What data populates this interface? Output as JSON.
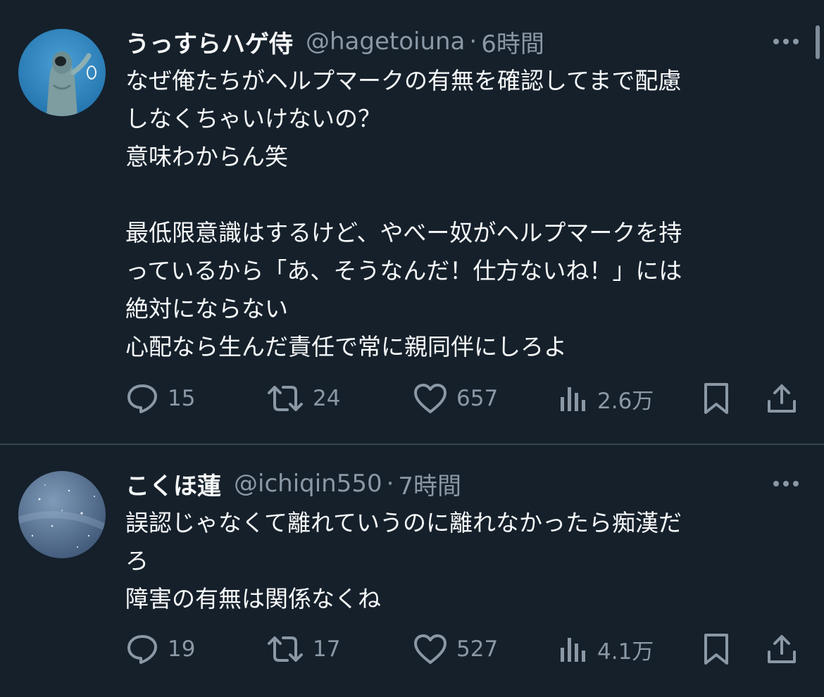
{
  "tweets": [
    {
      "display_name": "うっすらハゲ侍",
      "handle": "@hagetoiuna",
      "separator": "·",
      "time": "6時間",
      "text": "なぜ俺たちがヘルプマークの有無を確認してまで配慮\nしなくちゃいけないの？\n意味わからん笑\n\n最低限意識はするけど、やべー奴がヘルプマークを持\nっているから「あ、そうなんだ！仕方ないね！」には\n絶対にならない\n心配なら生んだ責任で常に親同伴にしろよ",
      "stats": {
        "replies": "15",
        "retweets": "24",
        "likes": "657",
        "views": "2.6万"
      }
    },
    {
      "display_name": "こくほ蓮",
      "handle": "@ichiqin550",
      "separator": "·",
      "time": "7時間",
      "text": "誤認じゃなくて離れていうのに離れなかったら痴漢だ\nろ\n障害の有無は関係なくね",
      "stats": {
        "replies": "19",
        "retweets": "17",
        "likes": "527",
        "views": "4.1万"
      }
    }
  ],
  "icons": {
    "reply": "reply-icon",
    "retweet": "retweet-icon",
    "like": "heart-icon",
    "views": "views-icon",
    "bookmark": "bookmark-icon",
    "share": "share-icon",
    "more": "more-icon"
  },
  "colors": {
    "background": "#15202b",
    "text": "#f7f9f9",
    "secondary": "#8b98a5",
    "divider": "#38444d"
  }
}
